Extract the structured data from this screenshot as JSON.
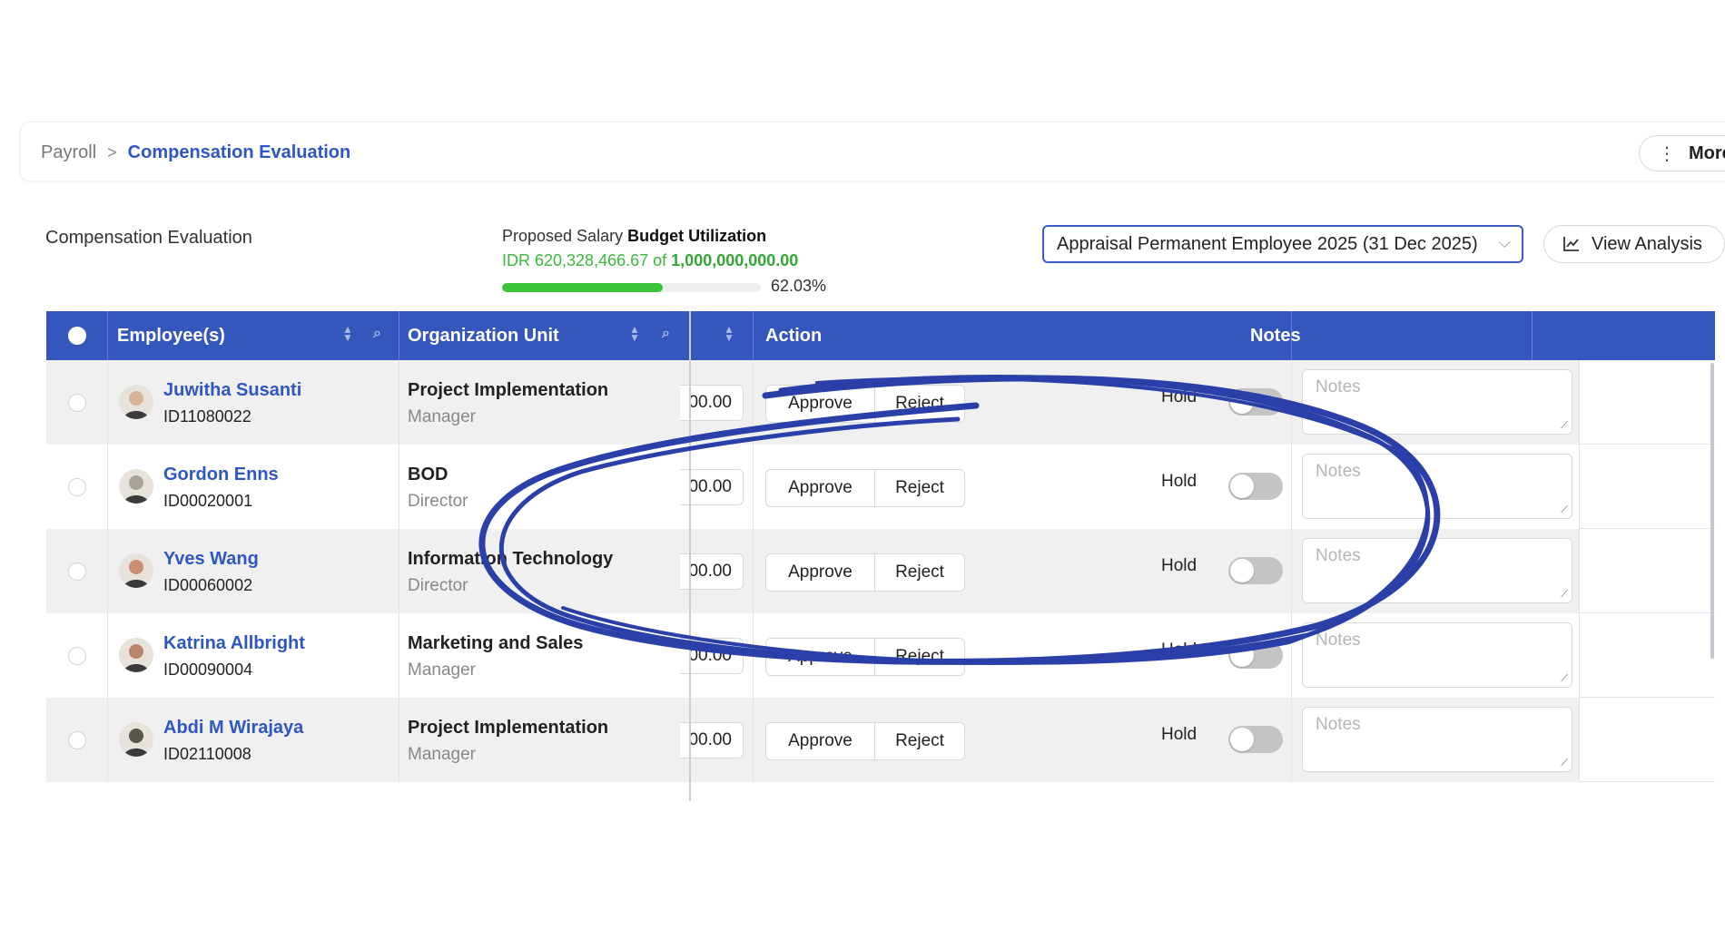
{
  "breadcrumb": {
    "root": "Payroll",
    "separator": ">",
    "current": "Compensation Evaluation"
  },
  "more_button": {
    "icon": "kebab-icon",
    "label": "More"
  },
  "page_title": "Compensation Evaluation",
  "budget": {
    "label_prefix": "Proposed Salary",
    "label_bold": "Budget Utilization",
    "used": "IDR 620,328,466.67",
    "of": "of",
    "total": "1,000,000,000.00",
    "percent_text": "62.03%",
    "fraction": 0.6203
  },
  "period_select": {
    "value": "Appraisal Permanent Employee 2025 (31 Dec 2025)",
    "icon": "chevron-down-icon"
  },
  "view_analysis": {
    "icon": "line-chart-icon",
    "label": "View Analysis"
  },
  "table": {
    "headers": {
      "employee": "Employee(s)",
      "org_unit": "Organization Unit",
      "action": "Action",
      "notes": "Notes"
    },
    "rows": [
      {
        "name": "Juwitha Susanti",
        "id": "ID11080022",
        "org": "Project Implementation",
        "position": "Manager",
        "amount": "00.00",
        "approve": "Approve",
        "reject": "Reject",
        "hold": "Hold",
        "notes_placeholder": "Notes",
        "avatar_color": "#d7b49a"
      },
      {
        "name": "Gordon Enns",
        "id": "ID00020001",
        "org": "BOD",
        "position": "Director",
        "amount": "00.00",
        "approve": "Approve",
        "reject": "Reject",
        "hold": "Hold",
        "notes_placeholder": "Notes",
        "avatar_color": "#a9a39a"
      },
      {
        "name": "Yves Wang",
        "id": "ID00060002",
        "org": "Information Technology",
        "position": "Director",
        "amount": "00.00",
        "approve": "Approve",
        "reject": "Reject",
        "hold": "Hold",
        "notes_placeholder": "Notes",
        "avatar_color": "#c98f6e"
      },
      {
        "name": "Katrina Allbright",
        "id": "ID00090004",
        "org": "Marketing and Sales",
        "position": "Manager",
        "amount": "00.00",
        "approve": "Approve",
        "reject": "Reject",
        "hold": "Hold",
        "notes_placeholder": "Notes",
        "avatar_color": "#b9866a"
      },
      {
        "name": "Abdi M Wirajaya",
        "id": "ID02110008",
        "org": "Project Implementation",
        "position": "Manager",
        "amount": "00.00",
        "approve": "Approve",
        "reject": "Reject",
        "hold": "Hold",
        "notes_placeholder": "Notes",
        "avatar_color": "#5b5550"
      }
    ]
  },
  "colors": {
    "header_blue": "#3556bd",
    "link_blue": "#2f57c2",
    "progress_green": "#3ac43a",
    "annotation_blue": "#2b3fa8"
  }
}
